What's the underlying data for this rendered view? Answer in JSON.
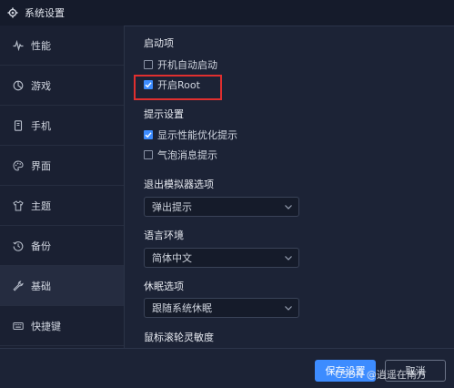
{
  "window": {
    "title": "系统设置"
  },
  "sidebar": {
    "items": [
      {
        "label": "性能",
        "icon": "pulse-icon"
      },
      {
        "label": "游戏",
        "icon": "game-icon"
      },
      {
        "label": "手机",
        "icon": "phone-icon"
      },
      {
        "label": "界面",
        "icon": "palette-icon"
      },
      {
        "label": "主题",
        "icon": "shirt-icon"
      },
      {
        "label": "备份",
        "icon": "history-icon"
      },
      {
        "label": "基础",
        "icon": "wrench-icon"
      },
      {
        "label": "快捷键",
        "icon": "keyboard-icon"
      }
    ],
    "active": "基础"
  },
  "startup": {
    "title": "启动项",
    "options": [
      {
        "label": "开机自动启动",
        "checked": false
      },
      {
        "label": "开启Root",
        "checked": true
      }
    ]
  },
  "tips": {
    "title": "提示设置",
    "options": [
      {
        "label": "显示性能优化提示",
        "checked": true
      },
      {
        "label": "气泡消息提示",
        "checked": false
      }
    ]
  },
  "exit": {
    "title": "退出模拟器选项",
    "value": "弹出提示"
  },
  "language": {
    "title": "语言环境",
    "value": "简体中文"
  },
  "sleep": {
    "title": "休眠选项",
    "value": "跟随系统休眠"
  },
  "scroll": {
    "title": "鼠标滚轮灵敏度"
  },
  "footer": {
    "save_label": "保存设置",
    "cancel_label": "取消"
  },
  "watermark": "CSDN @逍遥在南方",
  "colors": {
    "accent": "#3d8cff",
    "highlight": "#e02f2f",
    "background": "#1c2336"
  }
}
